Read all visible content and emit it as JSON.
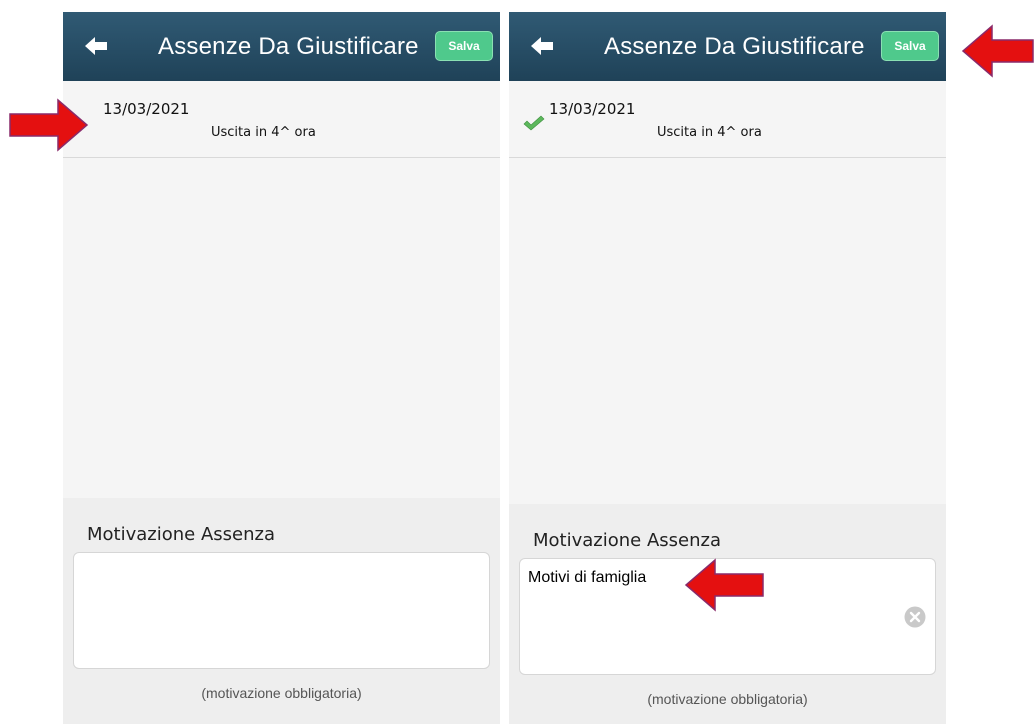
{
  "panels": {
    "left": {
      "header": {
        "title": "Assenze Da Giustificare",
        "save_label": "Salva"
      },
      "item": {
        "date": "13/03/2021",
        "description": "Uscita in 4^ ora"
      },
      "motivazione": {
        "label": "Motivazione Assenza",
        "value": "",
        "hint": "(motivazione obbligatoria)"
      }
    },
    "right": {
      "header": {
        "title": "Assenze Da Giustificare",
        "save_label": "Salva"
      },
      "item": {
        "date": "13/03/2021",
        "description": "Uscita in 4^ ora",
        "selected": true
      },
      "motivazione": {
        "label": "Motivazione Assenza",
        "value": "Motivi di famiglia",
        "hint": "(motivazione obbligatoria)"
      }
    }
  },
  "icons": {
    "back": "arrow-left-icon",
    "check": "checkmark-icon",
    "clear": "clear-x-icon",
    "annotation": "red-arrow-annotation"
  },
  "colors": {
    "header": "#274b62",
    "save_button": "#4fc98c",
    "check": "#5cb85c",
    "annotation_arrow": "#e41010"
  }
}
